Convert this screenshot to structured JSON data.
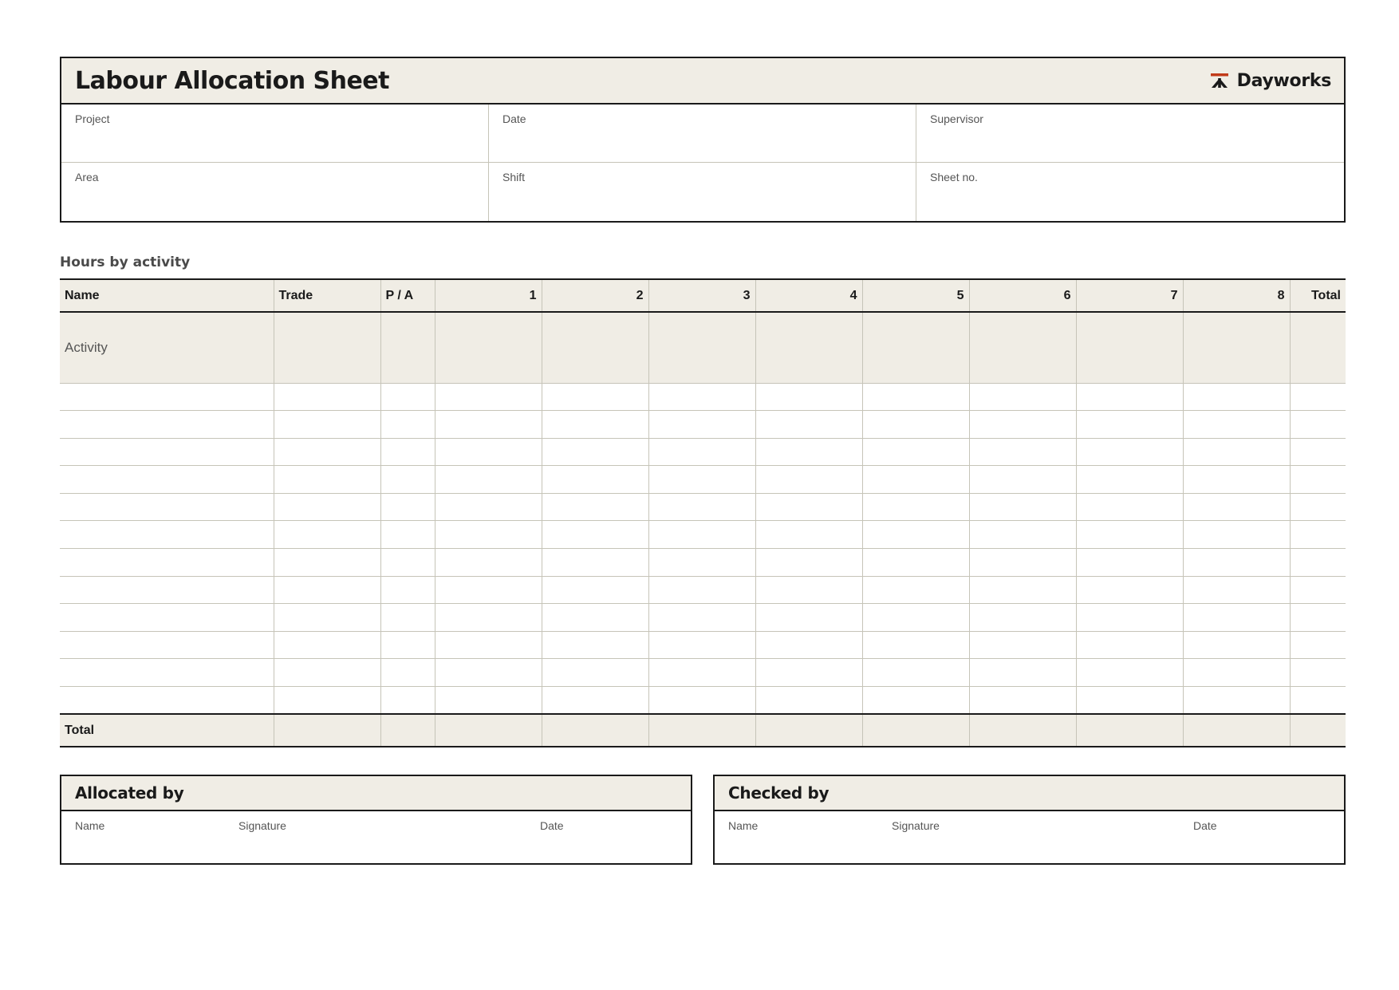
{
  "document": {
    "title": "Labour Allocation Sheet",
    "brand": {
      "name": "Dayworks",
      "icon": "dayworks-logo-icon",
      "icon_color": "#c23b1a"
    }
  },
  "info_fields": [
    {
      "label": "Project",
      "value": ""
    },
    {
      "label": "Date",
      "value": ""
    },
    {
      "label": "Supervisor",
      "value": ""
    },
    {
      "label": "Area",
      "value": ""
    },
    {
      "label": "Shift",
      "value": ""
    },
    {
      "label": "Sheet no.",
      "value": ""
    }
  ],
  "hours_section": {
    "heading": "Hours by activity",
    "columns": [
      "Name",
      "Trade",
      "P / A",
      "1",
      "2",
      "3",
      "4",
      "5",
      "6",
      "7",
      "8",
      "Total"
    ],
    "activity_label": "Activity",
    "total_label": "Total",
    "blank_rows": 12
  },
  "signoff": [
    {
      "title": "Allocated by",
      "labels": {
        "name": "Name",
        "signature": "Signature",
        "date": "Date"
      }
    },
    {
      "title": "Checked by",
      "labels": {
        "name": "Name",
        "signature": "Signature",
        "date": "Date"
      }
    }
  ],
  "colors": {
    "header_fill": "#f0ede5",
    "border": "#1a1a1a",
    "grid_line": "#c6c4b8"
  }
}
